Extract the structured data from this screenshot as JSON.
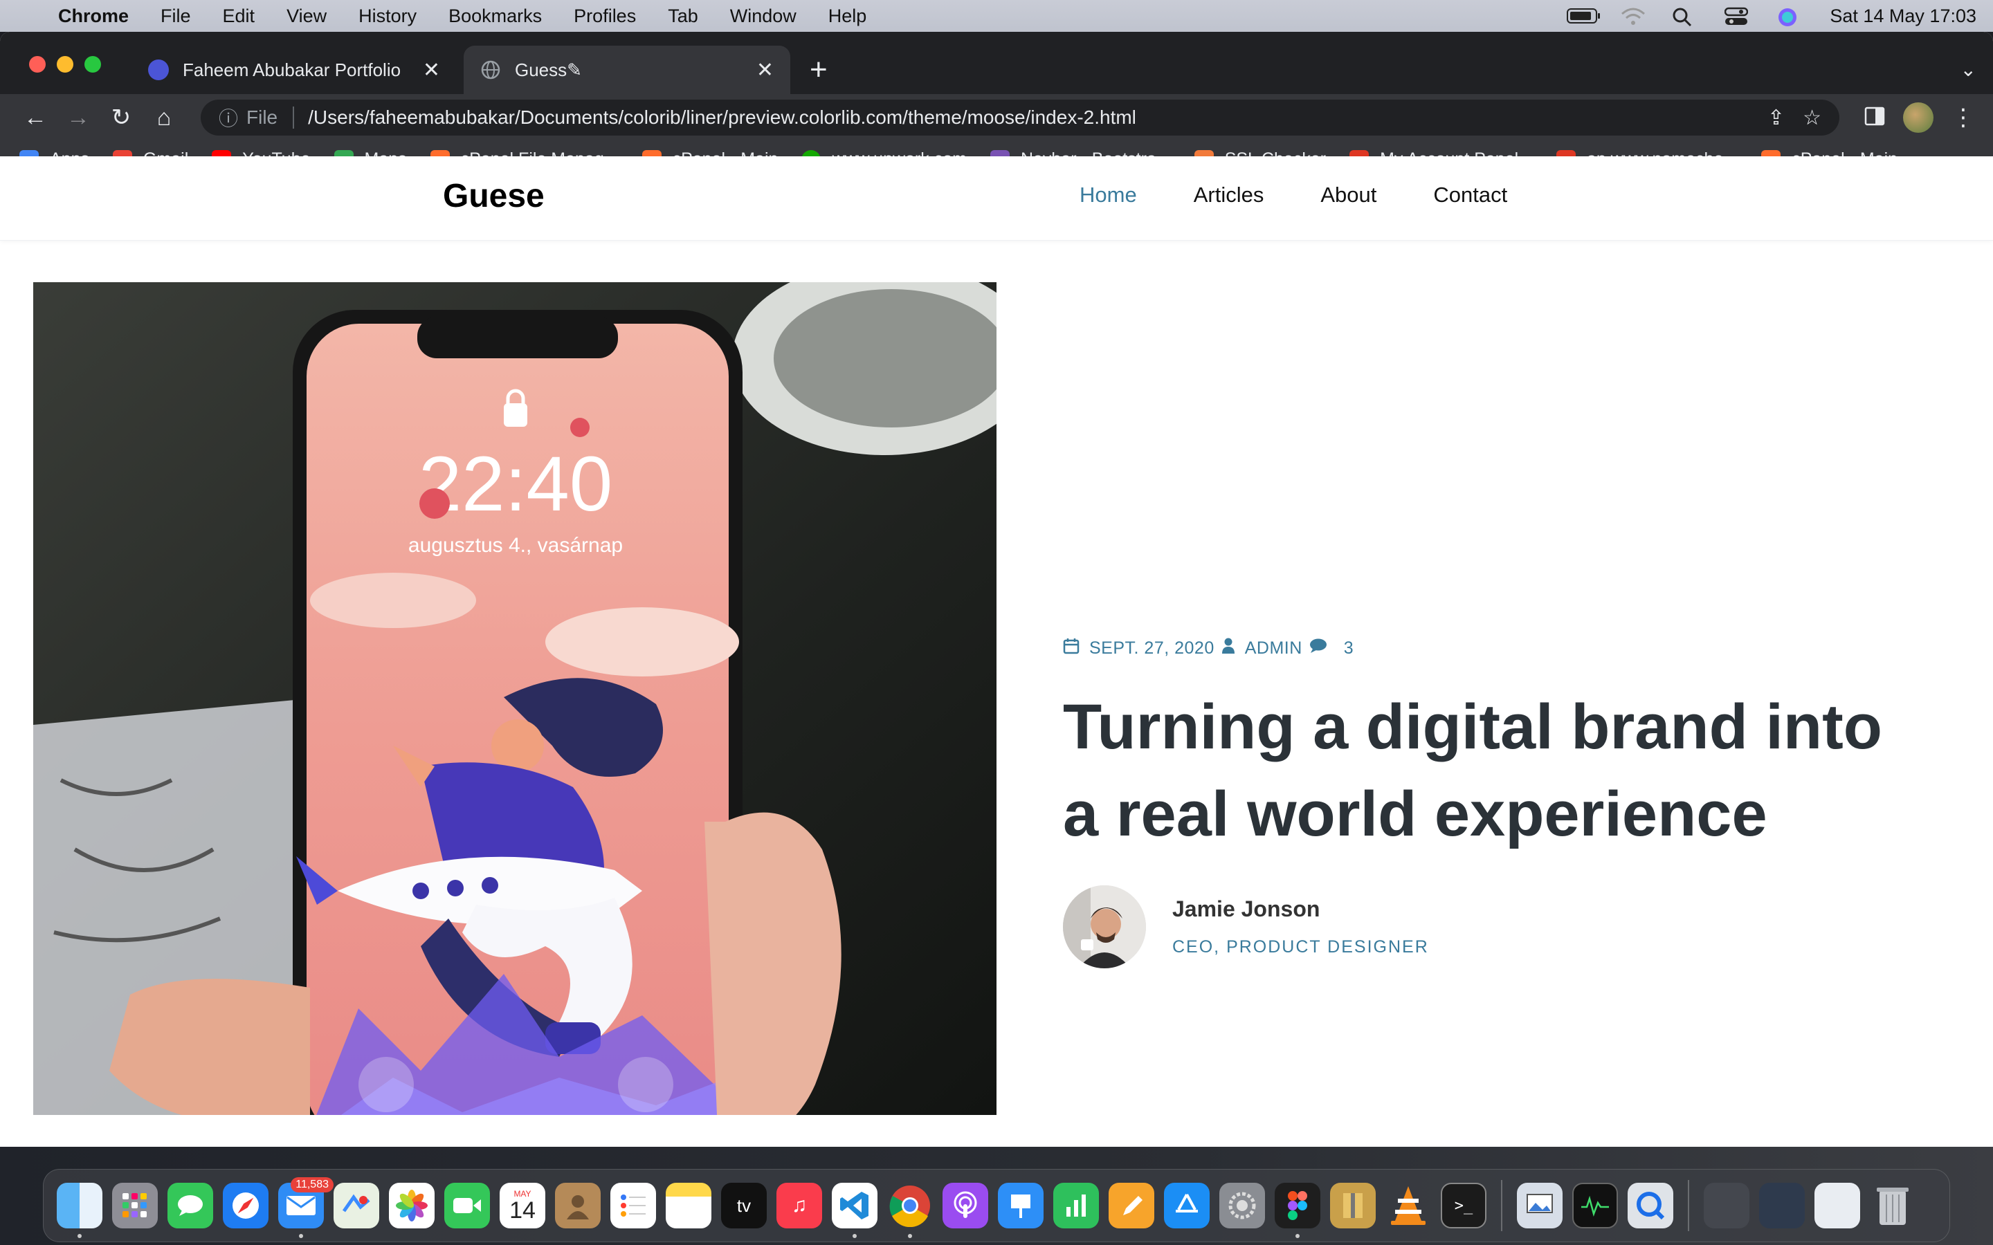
{
  "menubar": {
    "app": "Chrome",
    "items": [
      "File",
      "Edit",
      "View",
      "History",
      "Bookmarks",
      "Profiles",
      "Tab",
      "Window",
      "Help"
    ],
    "clock": "Sat 14 May  17:03"
  },
  "browser": {
    "tabs": [
      {
        "title": "Faheem Abubakar Portfolio",
        "favicon_color": "#4b55d6",
        "active": false
      },
      {
        "title": "Guess✎",
        "favicon_color": "#7a7c80",
        "active": true
      }
    ],
    "address": {
      "scheme": "File",
      "url": "/Users/faheemabubakar/Documents/colorib/liner/preview.colorlib.com/theme/moose/index-2.html"
    },
    "bookmarks": [
      {
        "label": "Apps",
        "icon": "grid-icon",
        "color": "#4285f4"
      },
      {
        "label": "Gmail",
        "icon": "gmail-icon",
        "color": "#ea4335"
      },
      {
        "label": "YouTube",
        "icon": "youtube-icon",
        "color": "#ff0000"
      },
      {
        "label": "Maps",
        "icon": "maps-icon",
        "color": "#34a853"
      },
      {
        "label": "cPanel File Manag...",
        "icon": "cpanel-icon",
        "color": "#ff6c2c"
      },
      {
        "label": "cPanel - Main",
        "icon": "cpanel-icon",
        "color": "#ff6c2c"
      },
      {
        "label": "www.upwork.com",
        "icon": "upwork-icon",
        "color": "#14a800"
      },
      {
        "label": "Navbar · Bootstra...",
        "icon": "bootstrap-icon",
        "color": "#7952b3"
      },
      {
        "label": "SSL Checker",
        "icon": "lock-icon",
        "color": "#f27a3a"
      },
      {
        "label": "My Account Panel...",
        "icon": "namecheap-icon",
        "color": "#de3723"
      },
      {
        "label": "ap.www.nameche...",
        "icon": "namecheap-icon",
        "color": "#de3723"
      },
      {
        "label": "cPanel - Main",
        "icon": "cpanel-icon",
        "color": "#ff6c2c"
      }
    ]
  },
  "site": {
    "brand": "Guese",
    "nav": [
      "Home",
      "Articles",
      "About",
      "Contact"
    ],
    "active_nav": "Home",
    "post": {
      "date": "SEPT. 27, 2020",
      "author_tag": "ADMIN",
      "comments": "3",
      "title": "Turning a digital brand into a real world experience",
      "author_name": "Jamie Jonson",
      "author_role": "CEO, PRODUCT DESIGNER"
    },
    "accent_color": "#3a7b9c"
  },
  "dock": {
    "mail_badge": "11,583",
    "calendar_month": "MAY",
    "calendar_day": "14",
    "tv_label": "tv"
  }
}
